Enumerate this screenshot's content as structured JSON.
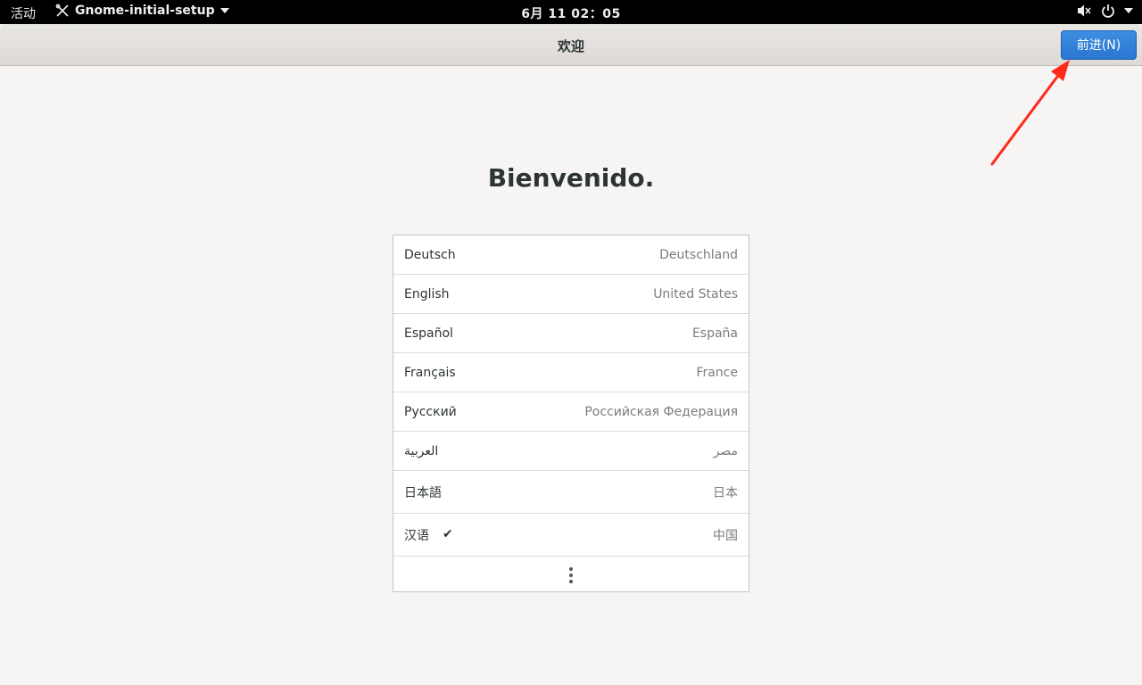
{
  "topbar": {
    "activities": "活动",
    "app_name": "Gnome-initial-setup",
    "clock": "6月 11  02：05"
  },
  "header": {
    "title": "欢迎",
    "next_button": "前进(N)"
  },
  "welcome": "Bienvenido.",
  "languages": [
    {
      "lang": "Deutsch",
      "region": "Deutschland"
    },
    {
      "lang": "English",
      "region": "United States"
    },
    {
      "lang": "Español",
      "region": "España"
    },
    {
      "lang": "Français",
      "region": "France"
    },
    {
      "lang": "Русский",
      "region": "Российская Федерация"
    },
    {
      "lang": "العربية",
      "region": "مصر"
    },
    {
      "lang": "日本語",
      "region": "日本"
    },
    {
      "lang": "汉语",
      "region": "中国",
      "selected": true
    }
  ],
  "colors": {
    "accent": "#2a76d2",
    "annotation_arrow": "#ff2a1a"
  },
  "icons": {
    "app_icon": "tools-icon",
    "volume": "volume-muted-icon",
    "power": "power-icon",
    "more": "more-vertical-icon",
    "check": "check-icon"
  }
}
